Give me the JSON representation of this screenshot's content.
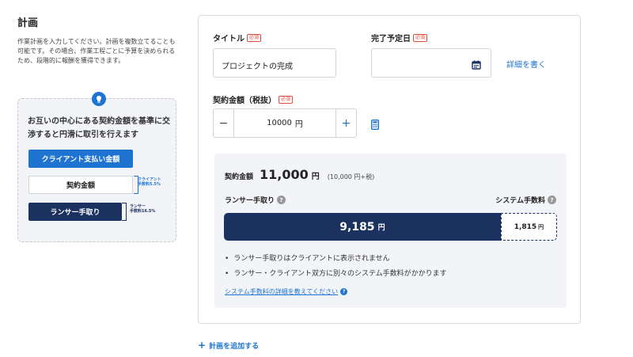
{
  "section": {
    "title": "計画",
    "description": "作業計画を入力してください。計画を複数立てることも可能です。その場合、作業工程ごとに予算を決められるため、段階的に報酬を獲得できます。"
  },
  "tip": {
    "text": "お互いの中心にある契約金額を基準に交渉すると円滑に取引を行えます",
    "client_button": "クライアント支払い金額",
    "contract_button": "契約金額",
    "lancer_button": "ランサー手取り",
    "client_fee_label": "クライアント",
    "client_fee_rate": "手数料5.5%",
    "lancer_fee_label": "ランサー",
    "lancer_fee_rate": "手数料16.5%"
  },
  "form": {
    "title_label": "タイトル",
    "required_badge": "必須",
    "title_value": "プロジェクトの完成",
    "date_label": "完了予定日",
    "date_value": "",
    "detail_link": "詳細を書く",
    "amount_label": "契約金額（税抜）",
    "amount_value": "10000",
    "amount_unit": "円",
    "minus": "−",
    "plus": "+"
  },
  "summary": {
    "contract_label": "契約金額",
    "contract_amount": "11,000",
    "yen": "円",
    "contract_note": "(10,000 円+税)",
    "lancer_label": "ランサー手取り",
    "fee_label": "システム手数料",
    "lancer_amount": "9,185",
    "fee_amount": "1,815",
    "lancer_share": 0.835,
    "notes": [
      "ランサー手取りはクライアントに表示されません",
      "ランサー・クライアント双方に別々のシステム手数料がかかります"
    ],
    "fee_link": "システム手数料の詳細を教えてください"
  },
  "add_plan": "計画を追加する",
  "colors": {
    "accent": "#1f74d2",
    "navy": "#1b3160",
    "required": "#e04b3e"
  }
}
